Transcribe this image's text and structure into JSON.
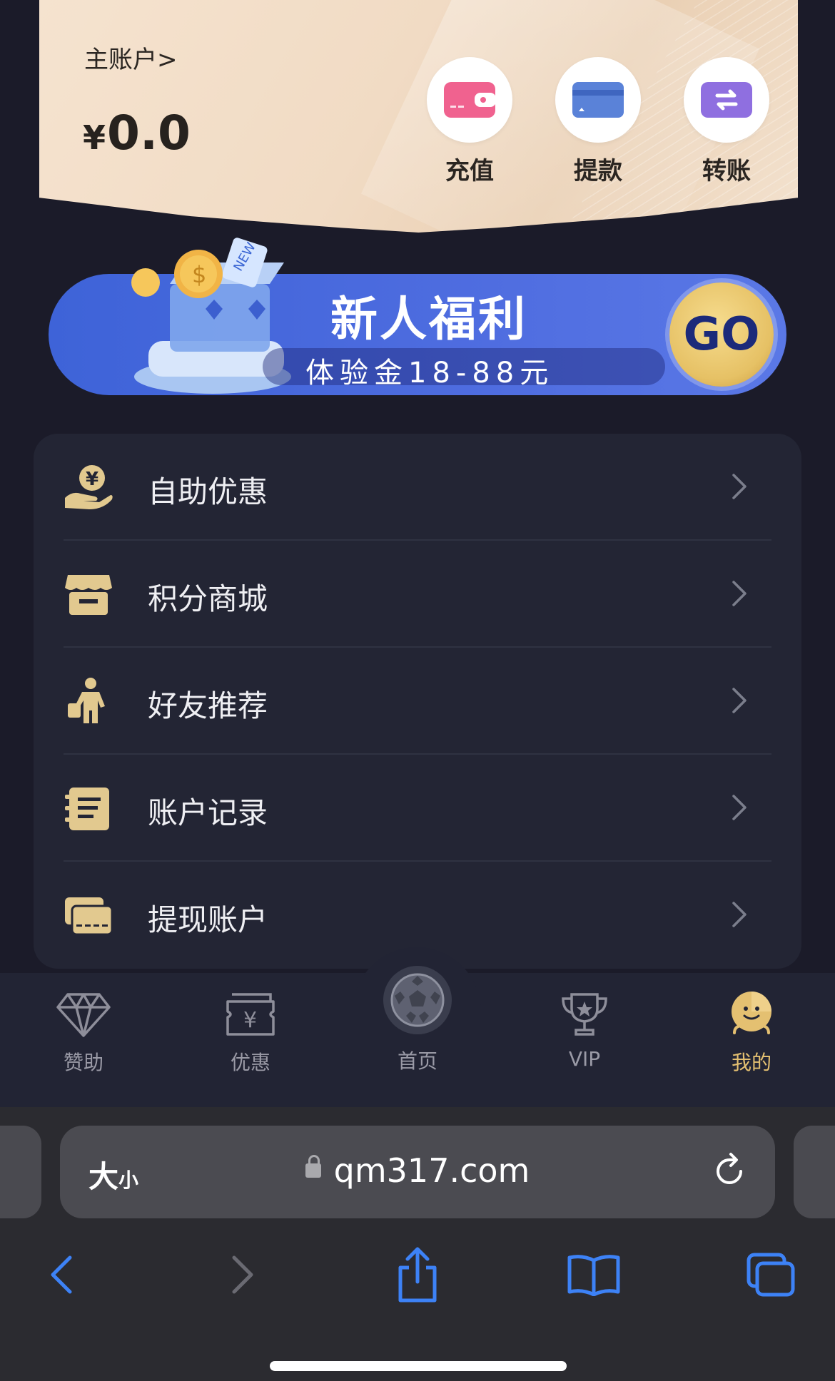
{
  "account": {
    "label": "主账户>",
    "currency": "¥",
    "balance": "0.0",
    "actions": [
      {
        "label": "充值",
        "icon": "wallet-icon",
        "color": "#f0628f"
      },
      {
        "label": "提款",
        "icon": "card-icon",
        "color": "#5a82d8"
      },
      {
        "label": "转账",
        "icon": "transfer-icon",
        "color": "#8f6fe0"
      }
    ]
  },
  "banner": {
    "title": "新人福利",
    "subtitle": "体验金18-88元",
    "button": "GO"
  },
  "menu": {
    "items": [
      {
        "label": "自助优惠",
        "icon": "money-hand-icon"
      },
      {
        "label": "积分商城",
        "icon": "shop-icon"
      },
      {
        "label": "好友推荐",
        "icon": "person-icon"
      },
      {
        "label": "账户记录",
        "icon": "notebook-icon"
      },
      {
        "label": "提现账户",
        "icon": "cards-icon"
      }
    ],
    "accent": "#e2c98f"
  },
  "tabbar": {
    "items": [
      {
        "label": "赞助",
        "icon": "diamond-icon"
      },
      {
        "label": "优惠",
        "icon": "ticket-icon"
      },
      {
        "label": "首页",
        "icon": "soccer-ball-icon"
      },
      {
        "label": "VIP",
        "icon": "trophy-icon"
      },
      {
        "label": "我的",
        "icon": "smiley-icon",
        "active": true
      }
    ],
    "active_color": "#e4c071"
  },
  "browser": {
    "text_size_big": "大",
    "text_size_small": "小",
    "domain": "qm317.com",
    "accent": "#3d82f6"
  }
}
